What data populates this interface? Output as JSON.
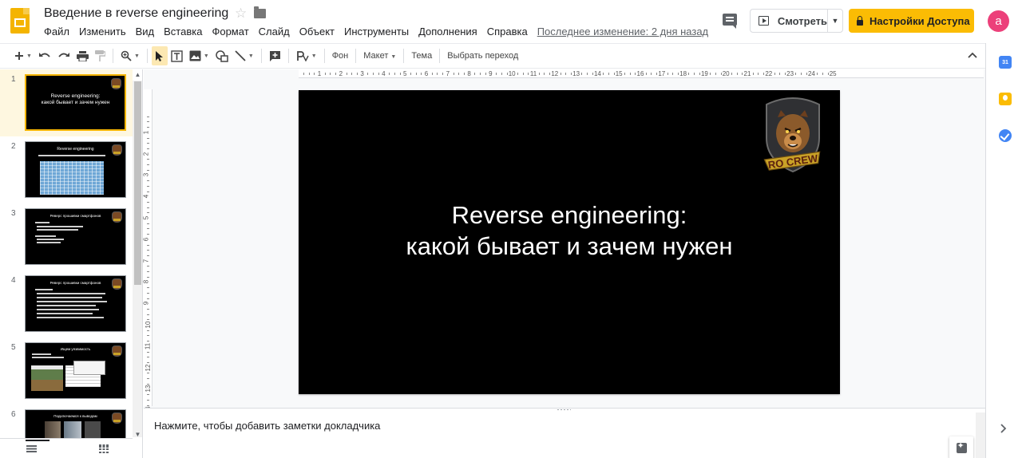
{
  "header": {
    "doc_title": "Введение в  reverse engineering",
    "menu": [
      "Файл",
      "Изменить",
      "Вид",
      "Вставка",
      "Формат",
      "Слайд",
      "Объект",
      "Инструменты",
      "Дополнения",
      "Справка"
    ],
    "last_edit": "Последнее изменение: 2 дня назад",
    "present_label": "Смотреть",
    "share_label": "Настройки Доступа",
    "avatar_letter": "a"
  },
  "toolbar": {
    "background_label": "Фон",
    "layout_label": "Макет",
    "theme_label": "Тема",
    "transition_label": "Выбрать переход"
  },
  "filmstrip": {
    "slides": [
      {
        "num": "1",
        "title_line1": "Reverse engineering:",
        "title_line2": "какой бывает и зачем нужен"
      },
      {
        "num": "2",
        "title": "Reverse engineering"
      },
      {
        "num": "3",
        "title": "Реверс прошивки смартфонов"
      },
      {
        "num": "4",
        "title": "Реверс прошивки смартфонов"
      },
      {
        "num": "5",
        "title": "Ищем уязвимость"
      },
      {
        "num": "6",
        "title": "Подключаемся к выводам"
      }
    ]
  },
  "ruler": {
    "top": [
      "1",
      "2",
      "3",
      "4",
      "5",
      "6",
      "7",
      "8",
      "9",
      "10",
      "11",
      "12",
      "13",
      "14",
      "15",
      "16",
      "17",
      "18",
      "19",
      "20",
      "21",
      "22",
      "23",
      "24",
      "25"
    ],
    "left": [
      "1",
      "2",
      "3",
      "4",
      "5",
      "6",
      "7",
      "8",
      "9",
      "10",
      "11",
      "12",
      "13",
      "14"
    ]
  },
  "slide": {
    "title_line1": "Reverse engineering:",
    "title_line2": "какой бывает и зачем нужен",
    "logo_text": "RO CREW"
  },
  "notes": {
    "placeholder": "Нажмите, чтобы добавить заметки докладчика"
  },
  "sidepanel": {
    "calendar_text": "31"
  },
  "colors": {
    "accent": "#fbbc04",
    "avatar": "#ec407a",
    "selected_slide_bg": "#fef7e0"
  }
}
